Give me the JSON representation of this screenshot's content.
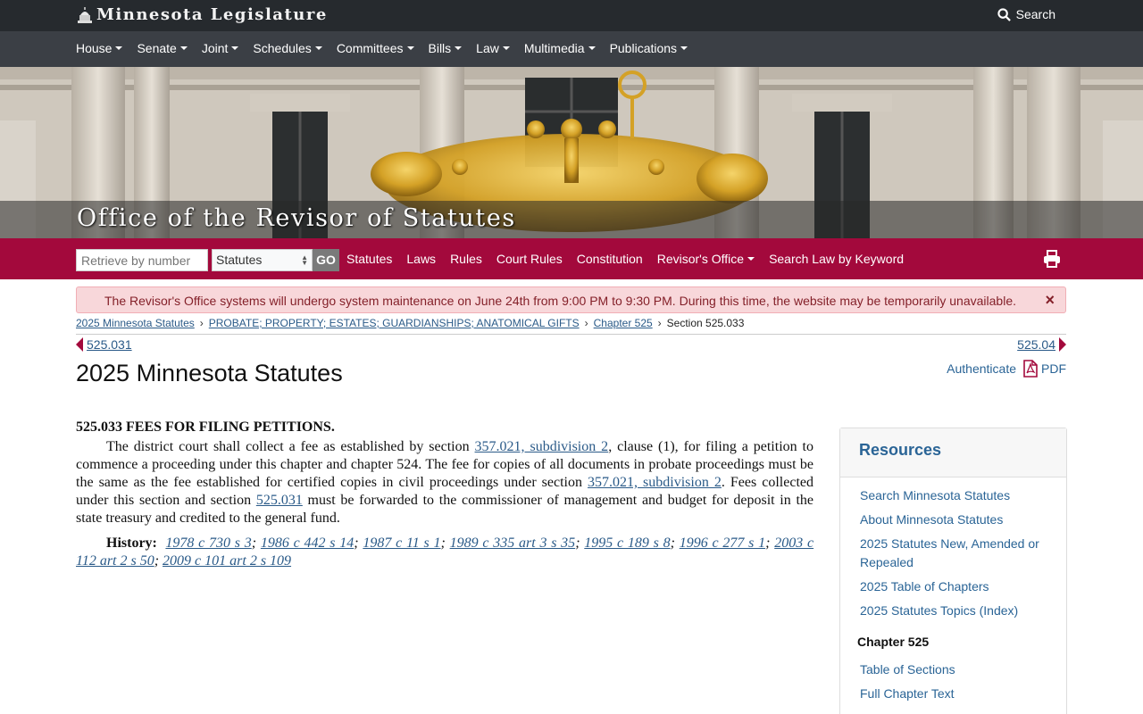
{
  "topbar": {
    "brand": "Minnesota Legislature",
    "search_label": "Search"
  },
  "nav": [
    "House",
    "Senate",
    "Joint",
    "Schedules",
    "Committees",
    "Bills",
    "Law",
    "Multimedia",
    "Publications"
  ],
  "hero": {
    "title": "Office of the Revisor of Statutes"
  },
  "revisor_bar": {
    "retrieve_placeholder": "Retrieve by number",
    "select_value": "Statutes",
    "go_label": "GO",
    "links": [
      "Statutes",
      "Laws",
      "Rules",
      "Court Rules",
      "Constitution",
      "Revisor's Office",
      "Search Law by Keyword"
    ]
  },
  "alert": {
    "message": "The Revisor's Office systems will undergo system maintenance on June 24th from 9:00 PM to 9:30 PM. During this time, the website may be temporarily unavailable.",
    "close": "×"
  },
  "breadcrumb": {
    "items": [
      "2025 Minnesota Statutes",
      "PROBATE; PROPERTY; ESTATES; GUARDIANSHIPS; ANATOMICAL GIFTS",
      "Chapter 525"
    ],
    "current": "Section 525.033"
  },
  "pager": {
    "prev": "525.031",
    "next": "525.04"
  },
  "page_title": "2025 Minnesota Statutes",
  "actions": {
    "authenticate": "Authenticate",
    "pdf": "PDF"
  },
  "statute": {
    "heading": "525.033 FEES FOR FILING PETITIONS.",
    "p1": "The district court shall collect a fee as established by section ",
    "link1": "357.021, subdivision 2",
    "p2": ", clause (1), for filing a petition to commence a proceeding under this chapter and chapter 524. The fee for copies of all documents in probate proceedings must be the same as the fee established for certified copies in civil proceedings under section ",
    "link2": "357.021, subdivision 2",
    "p3": ". Fees collected under this section and section ",
    "link3": "525.031",
    "p4": " must be forwarded to the commissioner of management and budget for deposit in the state treasury and credited to the general fund.",
    "history_label": "History:",
    "history": [
      "1978 c 730 s 3",
      "1986 c 442 s 14",
      "1987 c 11 s 1",
      "1989 c 335 art 3 s 35",
      "1995 c 189 s 8",
      "1996 c 277 s 1",
      "2003 c 112 art 2 s 50",
      "2009 c 101 art 2 s 109"
    ]
  },
  "resources": {
    "title": "Resources",
    "links": [
      "Search Minnesota Statutes",
      "About Minnesota Statutes",
      "2025 Statutes New, Amended or Repealed",
      "2025 Table of Chapters",
      "2025 Statutes Topics (Index)"
    ],
    "chapter_heading": "Chapter 525",
    "chapter_links": [
      "Table of Sections",
      "Full Chapter Text"
    ]
  },
  "colors": {
    "brand_red": "#a3093c",
    "topbar": "#262a2e",
    "nav": "#3b3f45",
    "link": "#2a6496"
  }
}
